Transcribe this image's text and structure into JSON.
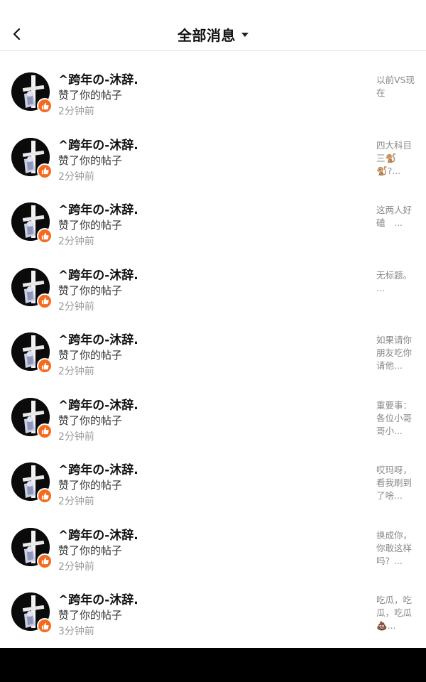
{
  "header": {
    "back_icon": "chevron-left-icon",
    "title": "全部消息",
    "dropdown_icon": "caret-down-icon"
  },
  "colors": {
    "badge": "#f46b1f",
    "time": "#999999",
    "preview": "#888888"
  },
  "notifications": [
    {
      "user": "^跨年の-沐辞.",
      "action": "赞了你的帖子",
      "time": "2分钟前",
      "preview": "以前VS现在"
    },
    {
      "user": "^跨年の-沐辞.",
      "action": "赞了你的帖子",
      "time": "2分钟前",
      "preview": "四大科目三🐒🐒?..."
    },
    {
      "user": "^跨年の-沐辞.",
      "action": "赞了你的帖子",
      "time": "2分钟前",
      "preview": "这两人好磕　..."
    },
    {
      "user": "^跨年の-沐辞.",
      "action": "赞了你的帖子",
      "time": "2分钟前",
      "preview": "无标题。　　..."
    },
    {
      "user": "^跨年の-沐辞.",
      "action": "赞了你的帖子",
      "time": "2分钟前",
      "preview": "如果请你朋友吃你请他..."
    },
    {
      "user": "^跨年の-沐辞.",
      "action": "赞了你的帖子",
      "time": "2分钟前",
      "preview": "重要事：各位小哥哥小..."
    },
    {
      "user": "^跨年の-沐辞.",
      "action": "赞了你的帖子",
      "time": "2分钟前",
      "preview": "哎玛呀，看我刷到了啥..."
    },
    {
      "user": "^跨年の-沐辞.",
      "action": "赞了你的帖子",
      "time": "2分钟前",
      "preview": "换成你，你敢这样吗？..."
    },
    {
      "user": "^跨年の-沐辞.",
      "action": "赞了你的帖子",
      "time": "3分钟前",
      "preview": "吃瓜，吃瓜，吃瓜💩..."
    }
  ]
}
